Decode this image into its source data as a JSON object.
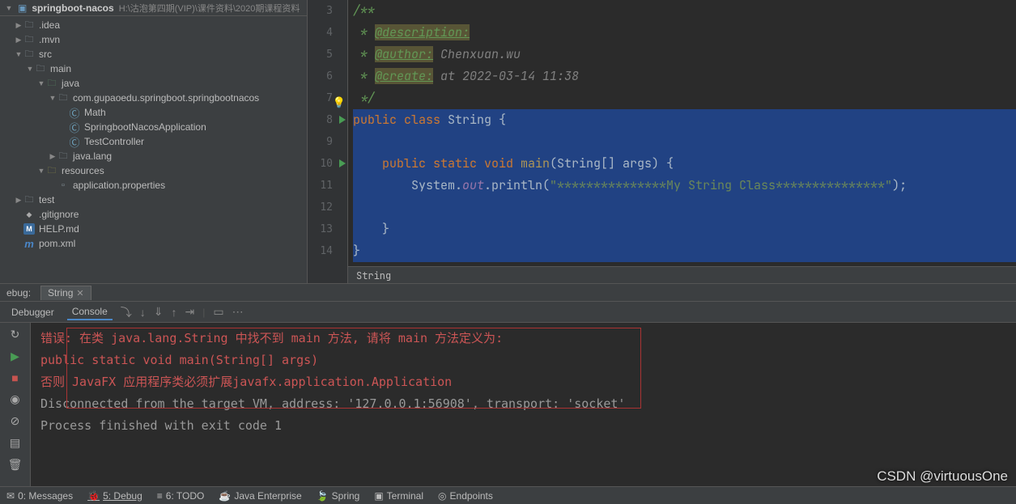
{
  "project": {
    "name": "springboot-nacos",
    "path": "H:\\沽泡第四期(VIP)\\课件资料\\2020期课程资料",
    "tree": [
      {
        "depth": 1,
        "arrow": "▶",
        "icon": "folder",
        "label": ".idea"
      },
      {
        "depth": 1,
        "arrow": "▶",
        "icon": "folder",
        "label": ".mvn"
      },
      {
        "depth": 1,
        "arrow": "▼",
        "icon": "folder",
        "label": "src"
      },
      {
        "depth": 2,
        "arrow": "▼",
        "icon": "folder",
        "label": "main"
      },
      {
        "depth": 3,
        "arrow": "▼",
        "icon": "srcfolder",
        "label": "java"
      },
      {
        "depth": 4,
        "arrow": "▼",
        "icon": "pkg",
        "label": "com.gupaoedu.springboot.springbootnacos"
      },
      {
        "depth": 5,
        "arrow": "",
        "icon": "class",
        "label": "Math"
      },
      {
        "depth": 5,
        "arrow": "",
        "icon": "class",
        "label": "SpringbootNacosApplication"
      },
      {
        "depth": 5,
        "arrow": "",
        "icon": "class",
        "label": "TestController"
      },
      {
        "depth": 4,
        "arrow": "▶",
        "icon": "pkg",
        "label": "java.lang"
      },
      {
        "depth": 3,
        "arrow": "▼",
        "icon": "resfolder",
        "label": "resources"
      },
      {
        "depth": 4,
        "arrow": "",
        "icon": "file",
        "label": "application.properties"
      },
      {
        "depth": 1,
        "arrow": "▶",
        "icon": "folder",
        "label": "test"
      },
      {
        "depth": 1,
        "arrow": "",
        "icon": "git",
        "label": ".gitignore"
      },
      {
        "depth": 1,
        "arrow": "",
        "icon": "md",
        "label": "HELP.md"
      },
      {
        "depth": 1,
        "arrow": "",
        "icon": "m",
        "label": "pom.xml"
      }
    ]
  },
  "editor": {
    "lines": [
      "3",
      "4",
      "5",
      "6",
      "7",
      "8",
      "9",
      "10",
      "11",
      "12",
      "13",
      "14"
    ],
    "code": {
      "doc_open": "/**",
      "desc_tag": "@description:",
      "author_tag": "@author:",
      "author_val": "Chenxuan.wu",
      "create_tag": "@create:",
      "create_val": "at 2022-03-14 11:38",
      "doc_close": "*/",
      "classline_pre": "public class ",
      "classname": "String",
      "classline_post": " {",
      "main_sig_pre": "    public static void ",
      "main_name": "main",
      "main_sig_post": "(String[] args) {",
      "println_pre": "        System.",
      "println_out": "out",
      "println_mid": ".println(",
      "println_str": "\"***************My String Class***************\"",
      "println_post": ");",
      "close1": "    }",
      "close2": "}"
    },
    "crumb": "String"
  },
  "debug": {
    "header_label": "ebug:",
    "tab_label": "String",
    "toolbar": {
      "debugger": "Debugger",
      "console": "Console"
    },
    "console_lines": {
      "l1a": "错误: 在类 ",
      "l1b": "java.lang.String",
      "l1c": " 中找不到 ",
      "l1d": "main",
      "l1e": " 方法, 请将 ",
      "l1f": "main",
      "l1g": " 方法定义为:",
      "l2": "   public static void main(String[] args)",
      "l3a": "否则 ",
      "l3b": "JavaFX",
      "l3c": " 应用程序类必须扩展",
      "l3d": "javafx.application.Application",
      "l4": "Disconnected from the target VM, address: '127.0.0.1:56908', transport: 'socket'",
      "l5": "",
      "l6": "Process finished with exit code 1"
    }
  },
  "statusbar": {
    "messages": "0: Messages",
    "debug": "5: Debug",
    "todo": "6: TODO",
    "java_ee": "Java Enterprise",
    "spring": "Spring",
    "terminal": "Terminal",
    "endpoints": "Endpoints"
  },
  "watermark": "CSDN @virtuousOne"
}
